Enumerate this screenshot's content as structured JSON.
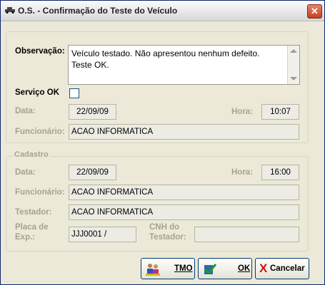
{
  "window": {
    "title": "O.S. - Confirmação do Teste do Veículo"
  },
  "form": {
    "observacao_label": "Observação:",
    "observacao_value": "Veículo testado. Não apresentou nenhum defeito.\nTeste OK.",
    "servico_ok_label": "Serviço OK",
    "servico_ok_checked": false,
    "data_label": "Data:",
    "data_value": "22/09/09",
    "hora_label": "Hora:",
    "hora_value": "10:07",
    "funcionario_label": "Funcionário:",
    "funcionario_value": "ACAO INFORMATICA"
  },
  "cadastro": {
    "section_label": "Cadastro",
    "data_label": "Data:",
    "data_value": "22/09/09",
    "hora_label": "Hora:",
    "hora_value": "16:00",
    "funcionario_label": "Funcionário:",
    "funcionario_value": "ACAO INFORMATICA",
    "testador_label": "Testador:",
    "testador_value": "ACAO INFORMATICA",
    "placa_label_1": "Placa de",
    "placa_label_2": "Exp.:",
    "placa_value": "JJJ0001 /",
    "cnh_label_1": "CNH do",
    "cnh_label_2": "Testador:",
    "cnh_value": ""
  },
  "buttons": {
    "tmo": "TMO",
    "ok": "OK",
    "cancelar_x": "X",
    "cancelar": "Cancelar"
  },
  "icons": {
    "title": "car-icon",
    "tmo": "people-icon",
    "ok": "checkmark-icon",
    "cancel": "red-x-icon"
  }
}
